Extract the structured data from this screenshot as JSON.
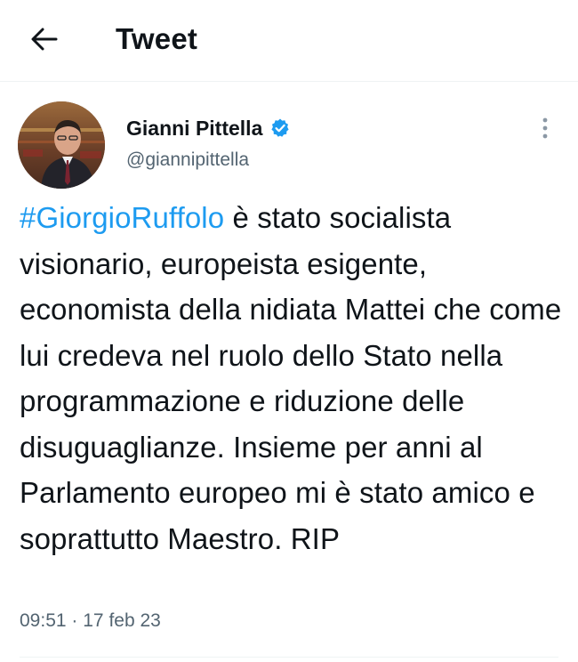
{
  "header": {
    "title": "Tweet",
    "back_icon": "arrow-left-icon"
  },
  "tweet": {
    "author": {
      "display_name": "Gianni Pittella",
      "handle": "@giannipittella",
      "verified": true,
      "verified_color": "#1d9bf0"
    },
    "more_icon": "more-vertical-icon",
    "text": {
      "hashtag": "#GiorgioRuffolo",
      "body": " è stato socialista visionario, europeista esigente, economista della nidiata Mattei che come lui credeva nel ruolo dello Stato nella programmazione e riduzione delle disuguaglianze. Insieme per anni al Parlamento europeo mi è stato amico e soprattutto Maestro. RIP"
    },
    "time": "09:51",
    "separator": "·",
    "date": "17 feb 23"
  },
  "colors": {
    "link": "#1d9bf0",
    "text_primary": "#0f1419",
    "text_secondary": "#536471",
    "divider": "#eff3f4"
  }
}
